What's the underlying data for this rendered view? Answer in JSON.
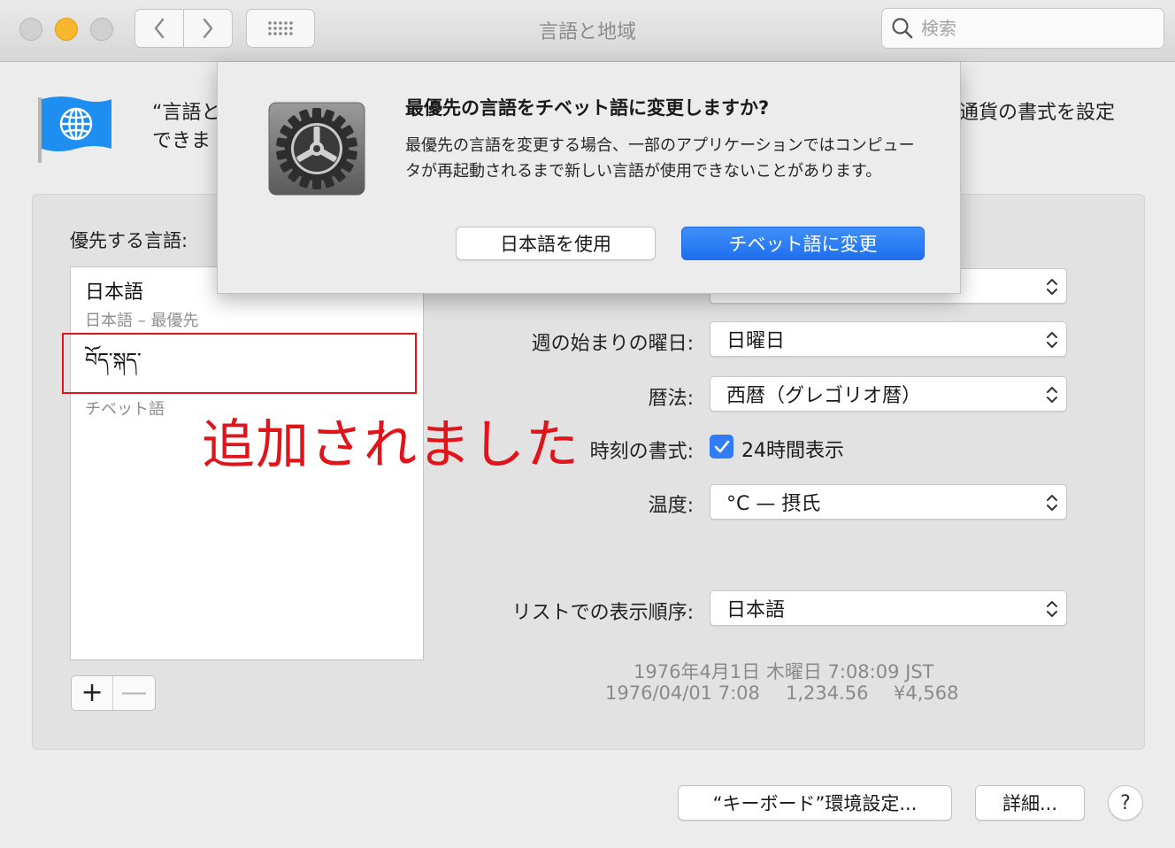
{
  "window": {
    "title": "言語と地域",
    "search_placeholder": "検索"
  },
  "header": {
    "description_left_line1": "“言語と",
    "description_left_line2": "できま",
    "description_right": "通貨の書式を設定"
  },
  "languages": {
    "label": "優先する言語:",
    "items": [
      {
        "name": "日本語",
        "sub": "日本語 – 最優先"
      },
      {
        "name": "བོད་སྐད་",
        "sub": "チベット語"
      }
    ],
    "add_label": "+",
    "remove_label": "—"
  },
  "annotation": "追加されました",
  "settings": {
    "week_start": {
      "label": "週の始まりの曜日:",
      "value": "日曜日"
    },
    "calendar": {
      "label": "暦法:",
      "value": "西暦（グレゴリオ暦）"
    },
    "time_format": {
      "label": "時刻の書式:",
      "checkbox_label": "24時間表示",
      "checked": true
    },
    "temperature": {
      "label": "温度:",
      "value": "°C — 摂氏"
    },
    "list_order": {
      "label": "リストでの表示順序:",
      "value": "日本語"
    }
  },
  "sample": {
    "line1": "1976年4月1日 木曜日 7:08:09 JST",
    "date_short": "1976/04/01 7:08",
    "number": "1,234.56",
    "currency": "¥4,568"
  },
  "buttons": {
    "keyboard": "“キーボード”環境設定...",
    "advanced": "詳細...",
    "help": "?"
  },
  "dialog": {
    "title": "最優先の言語をチベット語に変更しますか?",
    "body": "最優先の言語を変更する場合、一部のアプリケーションではコンピュータが再起動されるまで新しい言語が使用できないことがあります。",
    "secondary_button": "日本語を使用",
    "primary_button": "チベット語に変更"
  },
  "colors": {
    "accent": "#1f6ff0",
    "annotation_red": "#e0151b",
    "minimize_yellow": "#f6b72c"
  },
  "icons": [
    "flag-globe-icon",
    "gear-icon",
    "search-icon",
    "chevron-left-icon",
    "chevron-right-icon",
    "grid-icon",
    "checkmark-icon",
    "up-down-arrows-icon"
  ]
}
